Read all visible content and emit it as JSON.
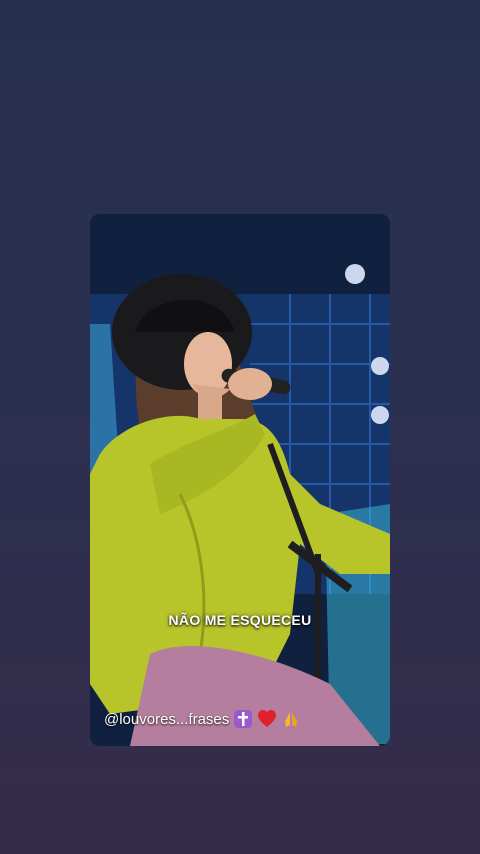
{
  "post": {
    "caption": "NÃO ME ESQUECEU",
    "handle": "@louvores...frases",
    "emojis": [
      "cross-icon",
      "heart-icon",
      "praying-hands-icon"
    ]
  },
  "colors": {
    "page_top": "#26304d",
    "page_bottom": "#352c4a",
    "shirt": "#b8c52a",
    "stage_blue": "#1d4f8e",
    "heart": "#e0202b",
    "cross_bg": "#9b59d0"
  }
}
